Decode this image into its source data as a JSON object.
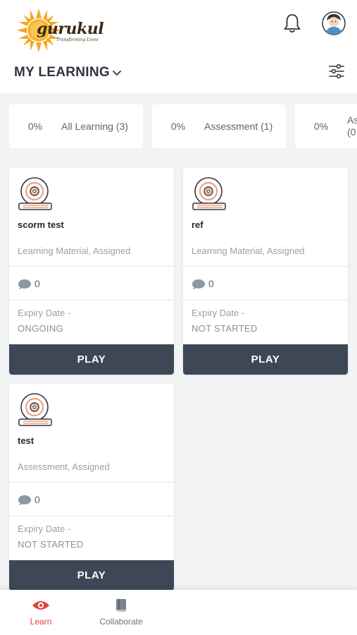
{
  "header": {
    "logo_text": "gurukul",
    "logo_tagline": "Transforming Lives",
    "title": "MY LEARNING"
  },
  "summary": [
    {
      "percent": "0%",
      "label": "All Learning (3)"
    },
    {
      "percent": "0%",
      "label": "Assessment (1)"
    },
    {
      "percent": "0%",
      "label": "As (0"
    }
  ],
  "cards": [
    {
      "name": "scorm test",
      "meta": "Learning Material, Assigned",
      "comments": "0",
      "expiry_label": "Expiry Date -",
      "expiry_value": "ONGOING",
      "play_label": "PLAY"
    },
    {
      "name": "ref",
      "meta": "Learning Material, Assigned",
      "comments": "0",
      "expiry_label": "Expiry Date -",
      "expiry_value": "NOT STARTED",
      "play_label": "PLAY"
    },
    {
      "name": "test",
      "meta": "Assessment, Assigned",
      "comments": "0",
      "expiry_label": "Expiry Date -",
      "expiry_value": "NOT STARTED",
      "play_label": "PLAY"
    }
  ],
  "nav": {
    "learn_label": "Learn",
    "collaborate_label": "Collaborate",
    "active": "Learn"
  },
  "icons": {
    "notification": "bell-icon",
    "profile": "avatar",
    "filter": "sliders-icon",
    "card": "disc-book-icon",
    "comment": "speech-bubble-icon",
    "learn": "eye-icon",
    "collaborate": "book-icon"
  },
  "colors": {
    "accent": "#e0403f",
    "play_button": "#3e4756",
    "page_background": "#f2f3f5",
    "logo_sun": "#f5a623",
    "card_icon_accent": "#f0a27a"
  }
}
